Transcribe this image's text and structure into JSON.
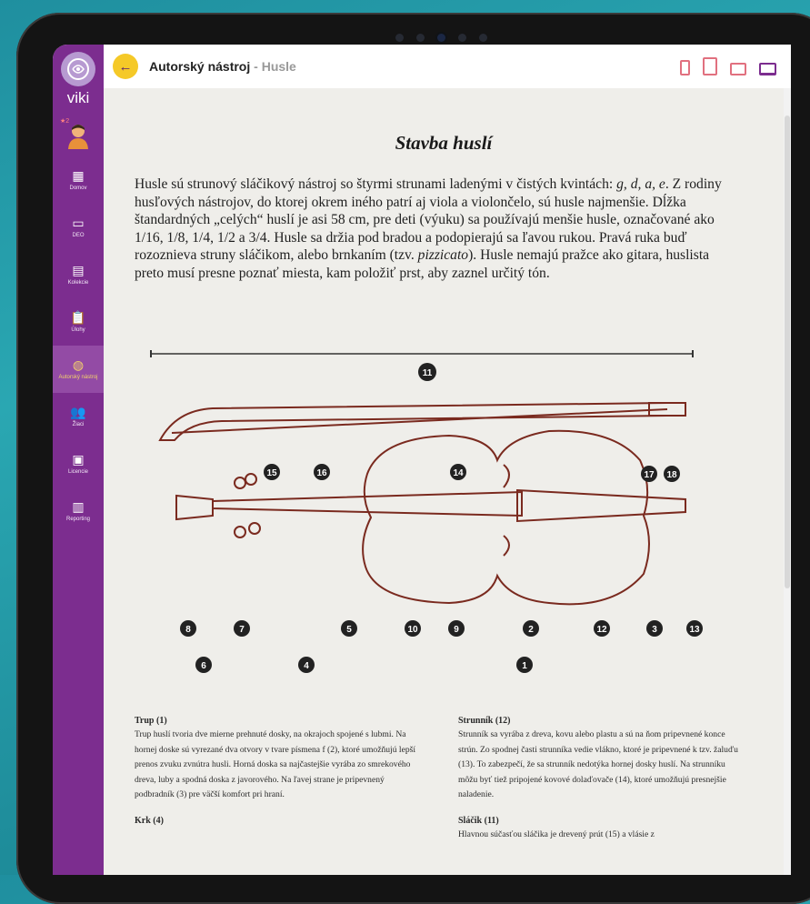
{
  "app": {
    "brand": "viki",
    "breadcrumb_main": "Autorský nástroj",
    "breadcrumb_sep": " - ",
    "breadcrumb_sub": "Husle"
  },
  "sidebar": {
    "items": [
      {
        "label": "Domov",
        "icon": "home-grid-icon"
      },
      {
        "label": "DEO",
        "icon": "monitor-icon"
      },
      {
        "label": "Kolekcie",
        "icon": "grid-icon"
      },
      {
        "label": "Úlohy",
        "icon": "clipboard-icon"
      },
      {
        "label": "Autorský nástroj",
        "icon": "palette-icon",
        "active": true
      },
      {
        "label": "Žiaci",
        "icon": "people-icon"
      },
      {
        "label": "Licencie",
        "icon": "license-icon"
      },
      {
        "label": "Reporting",
        "icon": "bar-chart-icon"
      }
    ],
    "avatar_badge": "★2"
  },
  "article": {
    "title": "Stavba huslí",
    "intro_html_parts": [
      "Husle sú strunový sláčikový nástroj so štyrmi strunami ladenými v čistých kvintách: ",
      "g, d, a, e",
      ". Z rodiny husľových nástrojov, do ktorej okrem iného patrí aj viola a violončelo, sú husle najmenšie. Dĺžka štandardných „celých“ huslí je asi 58 cm, pre deti (výuku) sa používajú menšie husle, označované ako 1/16, 1/8, 1/4, 1/2 a 3/4. Husle sa držia pod bradou a podopierajú sa ľavou rukou. Pravá ruka buď rozoznieva struny sláčikom, alebo brnkaním (tzv. ",
      "pizzicato",
      "). Husle nemajú pražce ako gitara, huslista preto musí presne poznať miesta, kam položiť prst, aby zaznel určitý tón."
    ]
  },
  "diagram": {
    "labels": {
      "n1": "1",
      "n2": "2",
      "n3": "3",
      "n4": "4",
      "n5": "5",
      "n6": "6",
      "n7": "7",
      "n8": "8",
      "n9": "9",
      "n10": "10",
      "n11": "11",
      "n12": "12",
      "n13": "13",
      "n14": "14",
      "n15": "15",
      "n16": "16",
      "n17": "17",
      "n18": "18"
    }
  },
  "sections": {
    "trup_title": "Trup (1)",
    "trup_text": "Trup huslí tvoria dve mierne prehnuté dosky, na okrajoch spojené s lubmi. Na hornej doske sú vyrezané dva otvory v tvare písmena f (2), ktoré umožňujú lepší prenos zvuku zvnútra husli. Horná doska sa najčastejšie vyrába zo smrekového dreva, luby a spodná doska z javorového. Na ľavej strane je pripevnený podbradník (3) pre väčší komfort pri hraní.",
    "krk_title": "Krk (4)",
    "strunnik_title": "Strunník (12)",
    "strunnik_text": "Strunník sa vyrába z dreva, kovu alebo plastu a sú na ňom pripevnené konce strún. Zo spodnej časti strunníka vedie vlákno, ktoré je pripevnené k tzv. žaluďu (13). To zabezpečí, že sa strunník nedotýka hornej dosky huslí. Na strunníku môžu byť tiež pripojené kovové dolaďovače (14), ktoré umožňujú presnejšie naladenie.",
    "slacik_title": "Sláčik (11)",
    "slacik_text": "Hlavnou súčasťou sláčika je drevený prút (15) a vlásie z"
  }
}
